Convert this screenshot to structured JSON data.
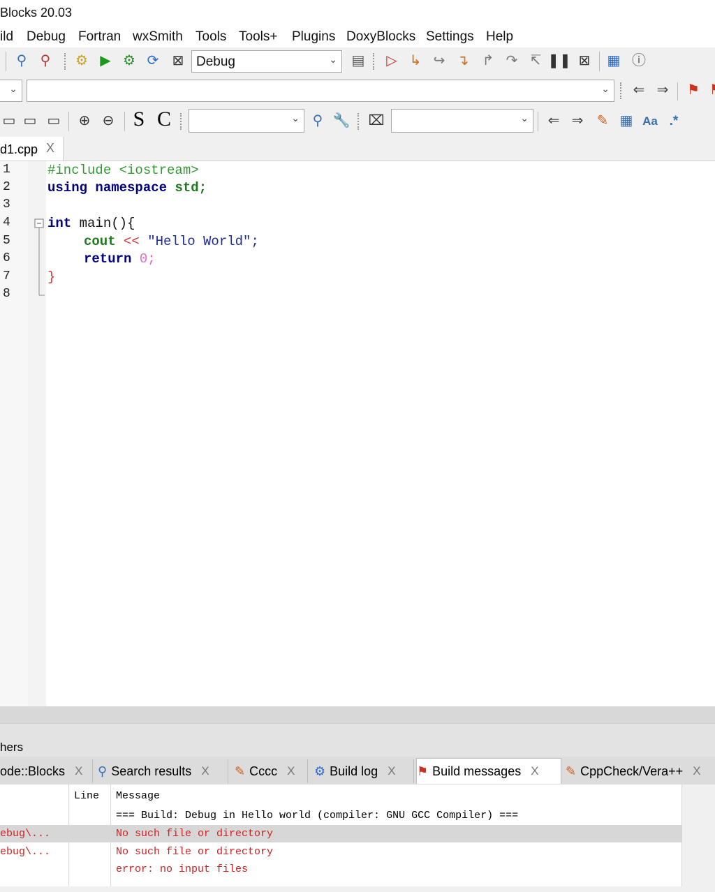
{
  "window": {
    "title": "Blocks 20.03"
  },
  "menu": [
    "ild",
    "Debug",
    "Fortran",
    "wxSmith",
    "Tools",
    "Tools+",
    "Plugins",
    "DoxyBlocks",
    "Settings",
    "Help"
  ],
  "toolbar": {
    "build_target": "Debug",
    "search_text": "S",
    "clear_text": "C",
    "aa_label": "Aa",
    "regex_label": ".*"
  },
  "editor": {
    "tab_label": "d1.cpp",
    "tab_close": "X",
    "line_numbers": [
      "1",
      "2",
      "3",
      "4",
      "5",
      "6",
      "7",
      "8"
    ],
    "code": {
      "l1": "#include <iostream>",
      "l2_kw": "using namespace",
      "l2_std": "std;",
      "l4_int": "int",
      "l4_rest": " main(){",
      "l5_cout": "cout",
      "l5_op": " << ",
      "l5_str": "\"Hello World\";",
      "l6_ret": "return",
      "l6_num": " 0;",
      "l7": "}"
    }
  },
  "bottom_panel": {
    "header": "hers",
    "tabs": [
      {
        "label": "ode::Blocks",
        "close": "X"
      },
      {
        "label": "Search results",
        "close": "X"
      },
      {
        "label": "Cccc",
        "close": "X"
      },
      {
        "label": "Build log",
        "close": "X"
      },
      {
        "label": "Build messages",
        "close": "X"
      },
      {
        "label": "CppCheck/Vera++",
        "close": "X"
      }
    ],
    "columns": {
      "line": "Line",
      "message": "Message"
    },
    "rows": [
      {
        "file": "",
        "message": "=== Build: Debug in Hello world (compiler: GNU GCC Compiler) ==="
      },
      {
        "file": "ebug\\...",
        "message": "No such file or directory"
      },
      {
        "file": "ebug\\...",
        "message": "No such file or directory"
      },
      {
        "file": "",
        "message": "error: no input files"
      }
    ]
  },
  "colors": {
    "error": "#d02020",
    "selected_row": "#d7d7d7",
    "keyword": "#000080",
    "preprocessor": "#2f9a2f"
  }
}
